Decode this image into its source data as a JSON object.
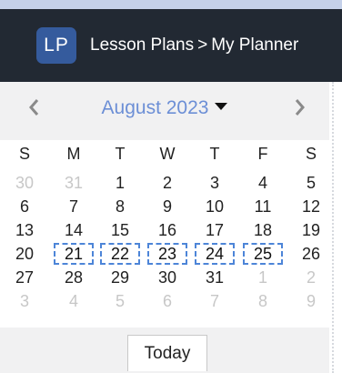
{
  "header": {
    "logo_text": "LP",
    "breadcrumb": {
      "root": "Lesson Plans",
      "separator": ">",
      "current": "My Planner"
    },
    "bg_color": "#222933",
    "logo_color": "#355b9d"
  },
  "calendar": {
    "month_label": "August 2023",
    "prev_icon": "chevron-left-icon",
    "next_icon": "chevron-right-icon",
    "dropdown_icon": "caret-down-icon",
    "weekdays": [
      "S",
      "M",
      "T",
      "W",
      "T",
      "F",
      "S"
    ],
    "weeks": [
      [
        {
          "d": "30",
          "o": true
        },
        {
          "d": "31",
          "o": true
        },
        {
          "d": "1"
        },
        {
          "d": "2"
        },
        {
          "d": "3"
        },
        {
          "d": "4"
        },
        {
          "d": "5"
        }
      ],
      [
        {
          "d": "6"
        },
        {
          "d": "7"
        },
        {
          "d": "8"
        },
        {
          "d": "9"
        },
        {
          "d": "10"
        },
        {
          "d": "11"
        },
        {
          "d": "12"
        }
      ],
      [
        {
          "d": "13"
        },
        {
          "d": "14"
        },
        {
          "d": "15"
        },
        {
          "d": "16"
        },
        {
          "d": "17"
        },
        {
          "d": "18"
        },
        {
          "d": "19"
        }
      ],
      [
        {
          "d": "20"
        },
        {
          "d": "21",
          "s": true
        },
        {
          "d": "22",
          "s": true
        },
        {
          "d": "23",
          "s": true
        },
        {
          "d": "24",
          "s": true
        },
        {
          "d": "25",
          "s": true
        },
        {
          "d": "26"
        }
      ],
      [
        {
          "d": "27"
        },
        {
          "d": "28"
        },
        {
          "d": "29"
        },
        {
          "d": "30"
        },
        {
          "d": "31"
        },
        {
          "d": "1",
          "o": true
        },
        {
          "d": "2",
          "o": true
        }
      ],
      [
        {
          "d": "3",
          "o": true
        },
        {
          "d": "4",
          "o": true
        },
        {
          "d": "5",
          "o": true
        },
        {
          "d": "6",
          "o": true
        },
        {
          "d": "7",
          "o": true
        },
        {
          "d": "8",
          "o": true
        },
        {
          "d": "9",
          "o": true
        }
      ]
    ],
    "today_label": "Today",
    "accent_color": "#6c8fd6",
    "selection_color": "#4d85d8"
  }
}
